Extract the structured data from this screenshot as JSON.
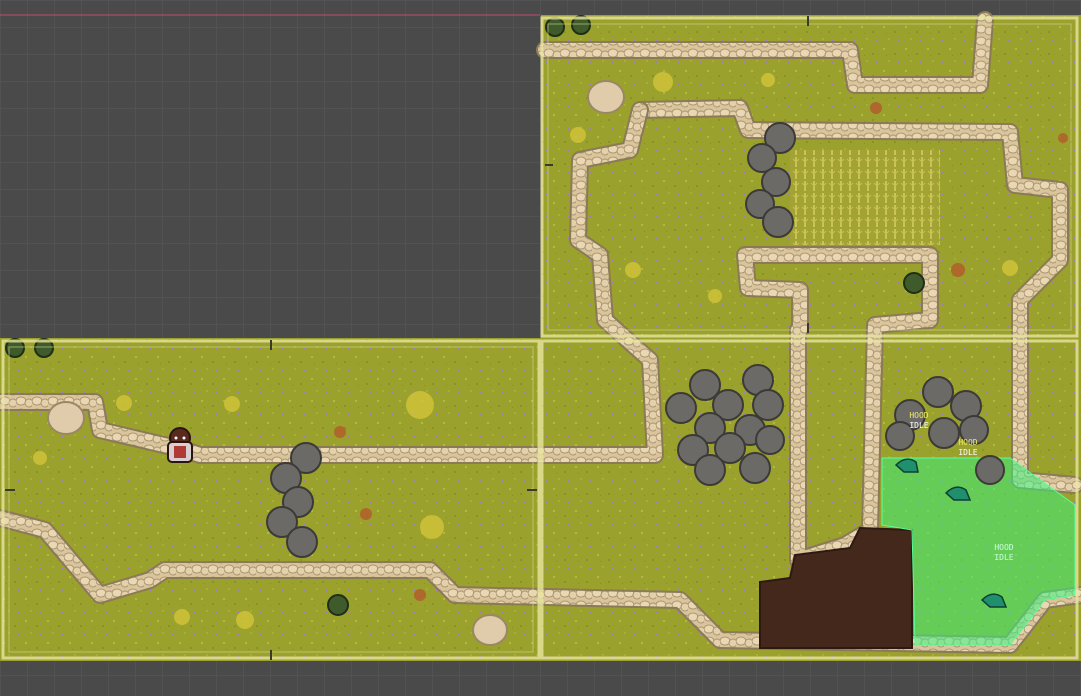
{
  "scene": {
    "background": "#4a4a4a",
    "grass": "#9aa12c",
    "grass_dark": "#8d9528",
    "stone": "#e3cfa7",
    "stone_shadow": "#9a8766",
    "rock": "#6c6a67",
    "rock_hi": "#8a8784",
    "dirt": "#45281c",
    "detection_zone": "#3cf07e",
    "room_border": "#e9e6a0"
  },
  "enemies": [
    {
      "name": "HOOD",
      "state": "IDLE"
    },
    {
      "name": "HOOD",
      "state": "IDLE"
    },
    {
      "name": "HOOD",
      "state": "IDLE"
    }
  ],
  "player": {
    "label": ""
  },
  "icons": {
    "player": "player-character-icon",
    "enemy": "hood-enemy-icon",
    "bush": "bush-icon",
    "boulder": "boulder-icon"
  }
}
